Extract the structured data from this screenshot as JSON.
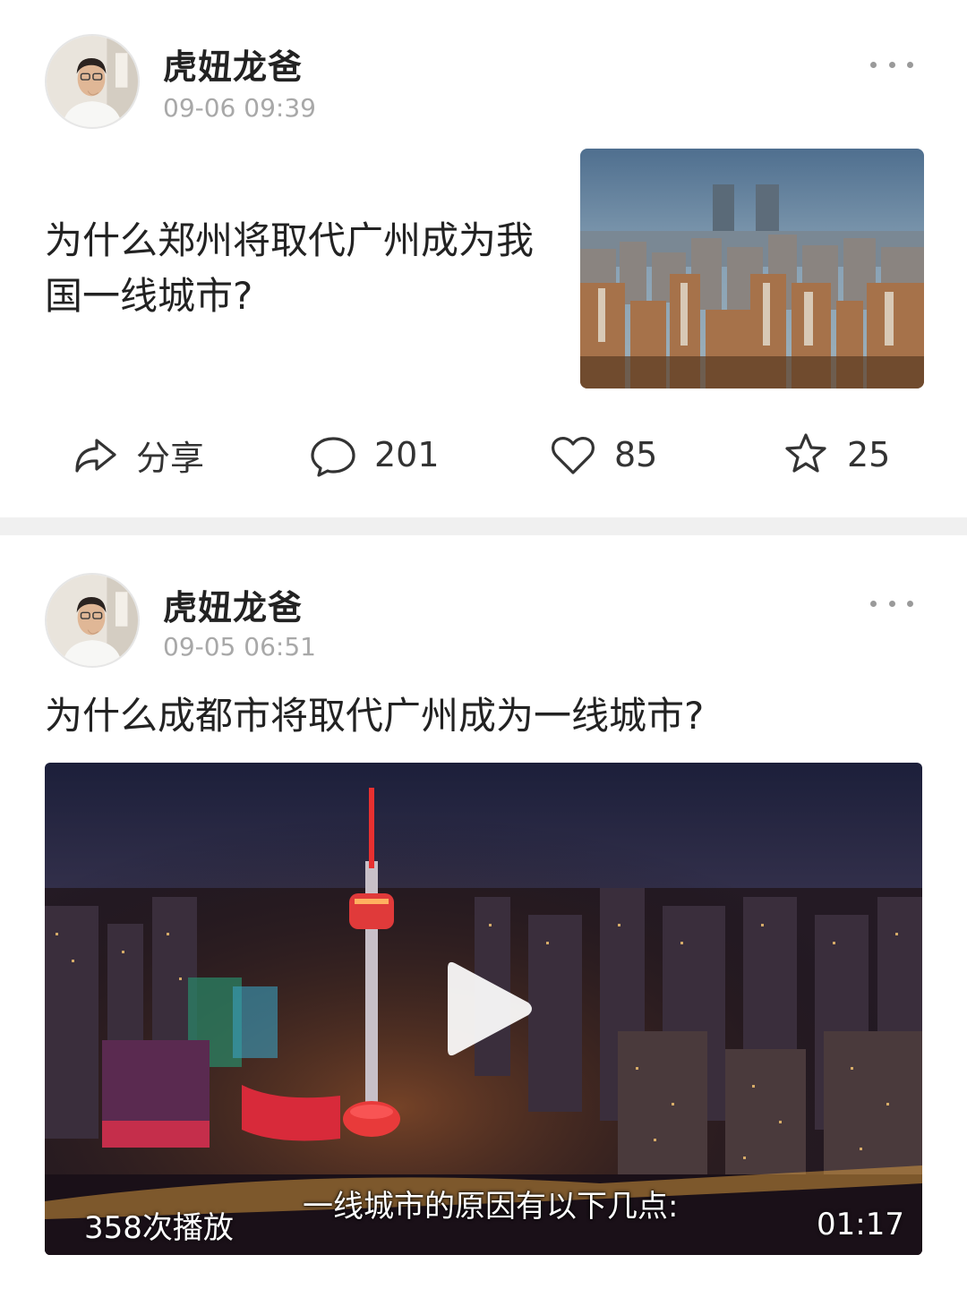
{
  "posts": [
    {
      "author": "虎妞龙爸",
      "time": "09-06 09:39",
      "title": "为什么郑州将取代广州成为我国一线城市?",
      "actions": {
        "share": "分享",
        "comments": "201",
        "likes": "85",
        "favorites": "25"
      }
    },
    {
      "author": "虎妞龙爸",
      "time": "09-05 06:51",
      "title": "为什么成都市将取代广州成为一线城市?",
      "video": {
        "subtitle": "一线城市的原因有以下几点:",
        "play_count": "358次播放",
        "duration": "01:17"
      }
    }
  ],
  "colors": {
    "divider": "#f0f0f0",
    "meta_text": "#a8a8a8",
    "primary_text": "#222222"
  },
  "icons": [
    "more-icon",
    "share-icon",
    "comment-icon",
    "like-icon",
    "favorite-icon",
    "play-icon"
  ]
}
